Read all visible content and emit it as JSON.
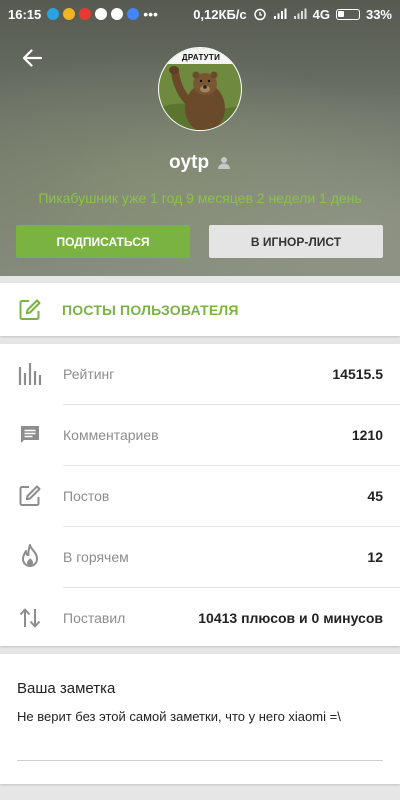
{
  "status_bar": {
    "time": "16:15",
    "network_speed": "0,12КБ/с",
    "network_type": "4G",
    "battery": "33%",
    "battery_level": 0.33
  },
  "profile": {
    "username": "oytp",
    "avatar_caption": "ДРАТУТИ",
    "tenure": "Пикабушник уже 1 год 9 месяцев 2 недели 1 день",
    "follow_label": "ПОДПИСАТЬСЯ",
    "ignore_label": "В ИГНОР-ЛИСТ"
  },
  "posts_link": {
    "label": "ПОСТЫ ПОЛЬЗОВАТЕЛЯ"
  },
  "stats": [
    {
      "icon": "bar-chart-icon",
      "label": "Рейтинг",
      "value": "14515.5"
    },
    {
      "icon": "comment-icon",
      "label": "Комментариев",
      "value": "1210"
    },
    {
      "icon": "edit-icon",
      "label": "Постов",
      "value": "45"
    },
    {
      "icon": "flame-icon",
      "label": "В горячем",
      "value": "12"
    },
    {
      "icon": "swap-vertical-icon",
      "label": "Поставил",
      "value": "10413 плюсов и 0 минусов"
    }
  ],
  "note": {
    "title": "Ваша заметка",
    "text": "Не верит без этой самой заметки, что у него xiaomi =\\"
  },
  "colors": {
    "accent": "#7bb342",
    "tenure_text": "#8bc34a",
    "icon_gray": "#8d8d8d"
  }
}
